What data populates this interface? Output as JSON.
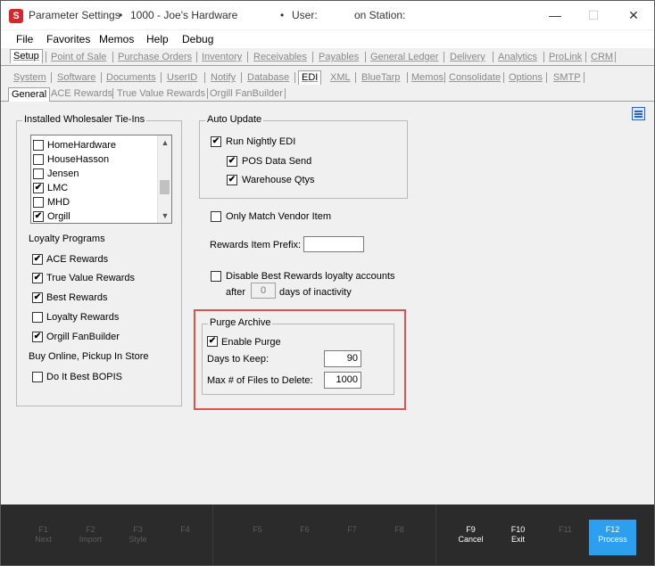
{
  "window": {
    "app_name": "Parameter Settings",
    "bullet": "•",
    "store": "1000 - Joe's Hardware",
    "user_label": "User:",
    "station_label": "on Station:",
    "controls": {
      "minimize": "—",
      "maximize": "☐",
      "close": "✕"
    }
  },
  "menu": [
    "File",
    "Favorites",
    "Memos",
    "Help",
    "Debug"
  ],
  "tabs_row1": [
    "Setup",
    "Point of Sale",
    "Purchase Orders",
    "Inventory",
    "Receivables",
    "Payables",
    "General Ledger",
    "Delivery",
    "Analytics",
    "ProLink",
    "CRM"
  ],
  "tabs_row2": [
    "System",
    "Software",
    "Documents",
    "UserID",
    "Notify",
    "Database",
    "EDI",
    "XML",
    "BlueTarp",
    "Memos",
    "Consolidate",
    "Options",
    "SMTP"
  ],
  "tabs_row3": [
    "General",
    "ACE Rewards",
    "True Value Rewards",
    "Orgill FanBuilder"
  ],
  "wholesaler": {
    "title": "Installed Wholesaler Tie-Ins",
    "items": [
      {
        "label": "HomeHardware",
        "checked": false
      },
      {
        "label": "HouseHasson",
        "checked": false
      },
      {
        "label": "Jensen",
        "checked": false
      },
      {
        "label": "LMC",
        "checked": true
      },
      {
        "label": "MHD",
        "checked": false
      },
      {
        "label": "Orgill",
        "checked": true
      }
    ],
    "scroll_up": "▲",
    "scroll_down": "▼"
  },
  "loyalty": {
    "title": "Loyalty Programs",
    "items": [
      {
        "label": "ACE Rewards",
        "checked": true
      },
      {
        "label": "True Value Rewards",
        "checked": true
      },
      {
        "label": "Best Rewards",
        "checked": true
      },
      {
        "label": "Loyalty Rewards",
        "checked": false
      },
      {
        "label": "Orgill FanBuilder",
        "checked": true
      }
    ]
  },
  "bopis": {
    "title": "Buy Online, Pickup In Store",
    "item": {
      "label": "Do It Best BOPIS",
      "checked": false
    }
  },
  "auto_update": {
    "title": "Auto Update",
    "run_nightly": {
      "label": "Run Nightly EDI",
      "checked": true
    },
    "pos_data": {
      "label": "POS Data Send",
      "checked": true
    },
    "warehouse": {
      "label": "Warehouse Qtys",
      "checked": true
    }
  },
  "only_match": {
    "label": "Only Match Vendor Item",
    "checked": false
  },
  "rewards_prefix": {
    "label": "Rewards Item Prefix:",
    "value": ""
  },
  "disable_best": {
    "label": "Disable Best Rewards loyalty accounts",
    "after": "after",
    "days_value": "0",
    "suffix": "days of inactivity",
    "checked": false
  },
  "purge": {
    "title": "Purge Archive",
    "enable": {
      "label": "Enable Purge",
      "checked": true
    },
    "days_label": "Days to Keep:",
    "days_value": "90",
    "max_label": "Max # of Files to Delete:",
    "max_value": "1000"
  },
  "check_mark": "✔",
  "function_keys": [
    {
      "key": "F1",
      "label": "Next",
      "enabled": false
    },
    {
      "key": "F2",
      "label": "Import",
      "enabled": false
    },
    {
      "key": "F3",
      "label": "Style",
      "enabled": false
    },
    {
      "key": "F4",
      "label": "",
      "enabled": false
    },
    {
      "key": "F5",
      "label": "",
      "enabled": false
    },
    {
      "key": "F6",
      "label": "",
      "enabled": false
    },
    {
      "key": "F7",
      "label": "",
      "enabled": false
    },
    {
      "key": "F8",
      "label": "",
      "enabled": false
    },
    {
      "key": "F9",
      "label": "Cancel",
      "enabled": true
    },
    {
      "key": "F10",
      "label": "Exit",
      "enabled": true
    },
    {
      "key": "F11",
      "label": "",
      "enabled": false
    },
    {
      "key": "F12",
      "label": "Process",
      "enabled": true,
      "primary": true
    }
  ],
  "colors": {
    "highlight": "#d9534f",
    "primary_key": "#2c9ff0",
    "app_icon": "#d9262c"
  }
}
